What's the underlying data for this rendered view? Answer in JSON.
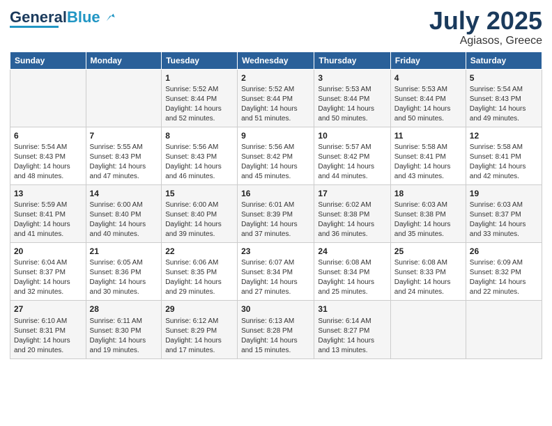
{
  "logo": {
    "text1": "General",
    "text2": "Blue"
  },
  "title": {
    "month_year": "July 2025",
    "location": "Agiasos, Greece"
  },
  "weekdays": [
    "Sunday",
    "Monday",
    "Tuesday",
    "Wednesday",
    "Thursday",
    "Friday",
    "Saturday"
  ],
  "weeks": [
    [
      {
        "day": "",
        "sunrise": "",
        "sunset": "",
        "daylight": ""
      },
      {
        "day": "",
        "sunrise": "",
        "sunset": "",
        "daylight": ""
      },
      {
        "day": "1",
        "sunrise": "Sunrise: 5:52 AM",
        "sunset": "Sunset: 8:44 PM",
        "daylight": "Daylight: 14 hours and 52 minutes."
      },
      {
        "day": "2",
        "sunrise": "Sunrise: 5:52 AM",
        "sunset": "Sunset: 8:44 PM",
        "daylight": "Daylight: 14 hours and 51 minutes."
      },
      {
        "day": "3",
        "sunrise": "Sunrise: 5:53 AM",
        "sunset": "Sunset: 8:44 PM",
        "daylight": "Daylight: 14 hours and 50 minutes."
      },
      {
        "day": "4",
        "sunrise": "Sunrise: 5:53 AM",
        "sunset": "Sunset: 8:44 PM",
        "daylight": "Daylight: 14 hours and 50 minutes."
      },
      {
        "day": "5",
        "sunrise": "Sunrise: 5:54 AM",
        "sunset": "Sunset: 8:43 PM",
        "daylight": "Daylight: 14 hours and 49 minutes."
      }
    ],
    [
      {
        "day": "6",
        "sunrise": "Sunrise: 5:54 AM",
        "sunset": "Sunset: 8:43 PM",
        "daylight": "Daylight: 14 hours and 48 minutes."
      },
      {
        "day": "7",
        "sunrise": "Sunrise: 5:55 AM",
        "sunset": "Sunset: 8:43 PM",
        "daylight": "Daylight: 14 hours and 47 minutes."
      },
      {
        "day": "8",
        "sunrise": "Sunrise: 5:56 AM",
        "sunset": "Sunset: 8:43 PM",
        "daylight": "Daylight: 14 hours and 46 minutes."
      },
      {
        "day": "9",
        "sunrise": "Sunrise: 5:56 AM",
        "sunset": "Sunset: 8:42 PM",
        "daylight": "Daylight: 14 hours and 45 minutes."
      },
      {
        "day": "10",
        "sunrise": "Sunrise: 5:57 AM",
        "sunset": "Sunset: 8:42 PM",
        "daylight": "Daylight: 14 hours and 44 minutes."
      },
      {
        "day": "11",
        "sunrise": "Sunrise: 5:58 AM",
        "sunset": "Sunset: 8:41 PM",
        "daylight": "Daylight: 14 hours and 43 minutes."
      },
      {
        "day": "12",
        "sunrise": "Sunrise: 5:58 AM",
        "sunset": "Sunset: 8:41 PM",
        "daylight": "Daylight: 14 hours and 42 minutes."
      }
    ],
    [
      {
        "day": "13",
        "sunrise": "Sunrise: 5:59 AM",
        "sunset": "Sunset: 8:41 PM",
        "daylight": "Daylight: 14 hours and 41 minutes."
      },
      {
        "day": "14",
        "sunrise": "Sunrise: 6:00 AM",
        "sunset": "Sunset: 8:40 PM",
        "daylight": "Daylight: 14 hours and 40 minutes."
      },
      {
        "day": "15",
        "sunrise": "Sunrise: 6:00 AM",
        "sunset": "Sunset: 8:40 PM",
        "daylight": "Daylight: 14 hours and 39 minutes."
      },
      {
        "day": "16",
        "sunrise": "Sunrise: 6:01 AM",
        "sunset": "Sunset: 8:39 PM",
        "daylight": "Daylight: 14 hours and 37 minutes."
      },
      {
        "day": "17",
        "sunrise": "Sunrise: 6:02 AM",
        "sunset": "Sunset: 8:38 PM",
        "daylight": "Daylight: 14 hours and 36 minutes."
      },
      {
        "day": "18",
        "sunrise": "Sunrise: 6:03 AM",
        "sunset": "Sunset: 8:38 PM",
        "daylight": "Daylight: 14 hours and 35 minutes."
      },
      {
        "day": "19",
        "sunrise": "Sunrise: 6:03 AM",
        "sunset": "Sunset: 8:37 PM",
        "daylight": "Daylight: 14 hours and 33 minutes."
      }
    ],
    [
      {
        "day": "20",
        "sunrise": "Sunrise: 6:04 AM",
        "sunset": "Sunset: 8:37 PM",
        "daylight": "Daylight: 14 hours and 32 minutes."
      },
      {
        "day": "21",
        "sunrise": "Sunrise: 6:05 AM",
        "sunset": "Sunset: 8:36 PM",
        "daylight": "Daylight: 14 hours and 30 minutes."
      },
      {
        "day": "22",
        "sunrise": "Sunrise: 6:06 AM",
        "sunset": "Sunset: 8:35 PM",
        "daylight": "Daylight: 14 hours and 29 minutes."
      },
      {
        "day": "23",
        "sunrise": "Sunrise: 6:07 AM",
        "sunset": "Sunset: 8:34 PM",
        "daylight": "Daylight: 14 hours and 27 minutes."
      },
      {
        "day": "24",
        "sunrise": "Sunrise: 6:08 AM",
        "sunset": "Sunset: 8:34 PM",
        "daylight": "Daylight: 14 hours and 25 minutes."
      },
      {
        "day": "25",
        "sunrise": "Sunrise: 6:08 AM",
        "sunset": "Sunset: 8:33 PM",
        "daylight": "Daylight: 14 hours and 24 minutes."
      },
      {
        "day": "26",
        "sunrise": "Sunrise: 6:09 AM",
        "sunset": "Sunset: 8:32 PM",
        "daylight": "Daylight: 14 hours and 22 minutes."
      }
    ],
    [
      {
        "day": "27",
        "sunrise": "Sunrise: 6:10 AM",
        "sunset": "Sunset: 8:31 PM",
        "daylight": "Daylight: 14 hours and 20 minutes."
      },
      {
        "day": "28",
        "sunrise": "Sunrise: 6:11 AM",
        "sunset": "Sunset: 8:30 PM",
        "daylight": "Daylight: 14 hours and 19 minutes."
      },
      {
        "day": "29",
        "sunrise": "Sunrise: 6:12 AM",
        "sunset": "Sunset: 8:29 PM",
        "daylight": "Daylight: 14 hours and 17 minutes."
      },
      {
        "day": "30",
        "sunrise": "Sunrise: 6:13 AM",
        "sunset": "Sunset: 8:28 PM",
        "daylight": "Daylight: 14 hours and 15 minutes."
      },
      {
        "day": "31",
        "sunrise": "Sunrise: 6:14 AM",
        "sunset": "Sunset: 8:27 PM",
        "daylight": "Daylight: 14 hours and 13 minutes."
      },
      {
        "day": "",
        "sunrise": "",
        "sunset": "",
        "daylight": ""
      },
      {
        "day": "",
        "sunrise": "",
        "sunset": "",
        "daylight": ""
      }
    ]
  ]
}
